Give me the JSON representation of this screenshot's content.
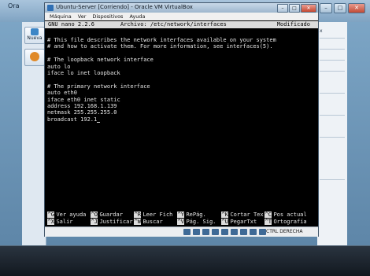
{
  "host": {
    "title": "Ora",
    "tools": [
      "Nueva",
      ""
    ],
    "right_panel": [
      "x",
      "",
      "",
      "",
      "",
      "",
      ""
    ]
  },
  "vm": {
    "title": "Ubuntu-Server [Corriendo] - Oracle VM VirtualBox",
    "menu": [
      "Máquina",
      "Ver",
      "Dispositivos",
      "Ayuda"
    ],
    "host_key": "CTRL DERECHA"
  },
  "nano": {
    "version": "GNU nano 2.2.6",
    "file": "Archivo: /etc/network/interfaces",
    "status": "Modificado"
  },
  "file_lines": [
    "# This file describes the network interfaces available on your system",
    "# and how to activate them. For more information, see interfaces(5).",
    "",
    "# The loopback network interface",
    "auto lo",
    "iface lo inet loopback",
    "",
    "# The primary network interface",
    "auto eth0",
    "iface eth0 inet static",
    "address 192.168.1.139",
    "netmask 255.255.255.0",
    "broadcast 192.1"
  ],
  "shortcuts": {
    "row1": [
      {
        "key": "^G",
        "label": "Ver ayuda"
      },
      {
        "key": "^O",
        "label": "Guardar"
      },
      {
        "key": "^R",
        "label": "Leer Fich"
      },
      {
        "key": "^Y",
        "label": "RePág."
      },
      {
        "key": "^K",
        "label": "Cortar Tex"
      },
      {
        "key": "^C",
        "label": "Pos actual"
      }
    ],
    "row2": [
      {
        "key": "^X",
        "label": "Salir"
      },
      {
        "key": "^J",
        "label": "Justificar"
      },
      {
        "key": "^W",
        "label": "Buscar"
      },
      {
        "key": "^V",
        "label": "Pág. Sig."
      },
      {
        "key": "^U",
        "label": "PegarTxt"
      },
      {
        "key": "^T",
        "label": "Ortografía"
      }
    ]
  }
}
